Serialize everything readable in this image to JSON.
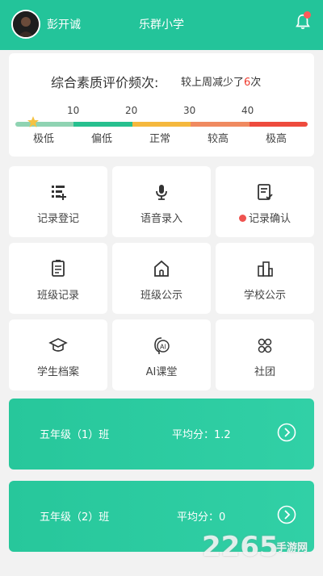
{
  "header": {
    "user_name": "彭开诚",
    "school_name": "乐群小学",
    "bell_icon": "bell-icon",
    "bell_badge_color": "#ff5a5a",
    "brand_color": "#23c49a"
  },
  "frequency": {
    "title": "综合素质评价频次:",
    "compare_prefix": "较上周减少了",
    "compare_value": "6",
    "compare_suffix": "次",
    "ticks": [
      "10",
      "20",
      "30",
      "40"
    ],
    "levels": [
      "极低",
      "偏低",
      "正常",
      "较高",
      "极高"
    ],
    "level_colors": [
      "#8fd3b2",
      "#27c08f",
      "#f5b83d",
      "#f08a60",
      "#ee4b3d"
    ],
    "current_level": "极低",
    "marker_icon": "star-icon"
  },
  "tiles": [
    {
      "label": "记录登记",
      "icon": "record-register-icon"
    },
    {
      "label": "语音录入",
      "icon": "microphone-icon"
    },
    {
      "label": "记录确认",
      "icon": "record-confirm-icon",
      "badge": true
    },
    {
      "label": "班级记录",
      "icon": "class-record-icon"
    },
    {
      "label": "班级公示",
      "icon": "class-notice-icon"
    },
    {
      "label": "学校公示",
      "icon": "school-notice-icon"
    },
    {
      "label": "学生档案",
      "icon": "graduation-cap-icon"
    },
    {
      "label": "AI课堂",
      "icon": "ai-class-icon"
    },
    {
      "label": "社团",
      "icon": "club-icon"
    }
  ],
  "classes": [
    {
      "name": "五年级（1）班",
      "score_label": "平均分：1.2"
    },
    {
      "name": "五年级（2）班",
      "score_label": "平均分：0"
    }
  ],
  "watermark": {
    "text": "2265",
    "sub": "手游网"
  }
}
